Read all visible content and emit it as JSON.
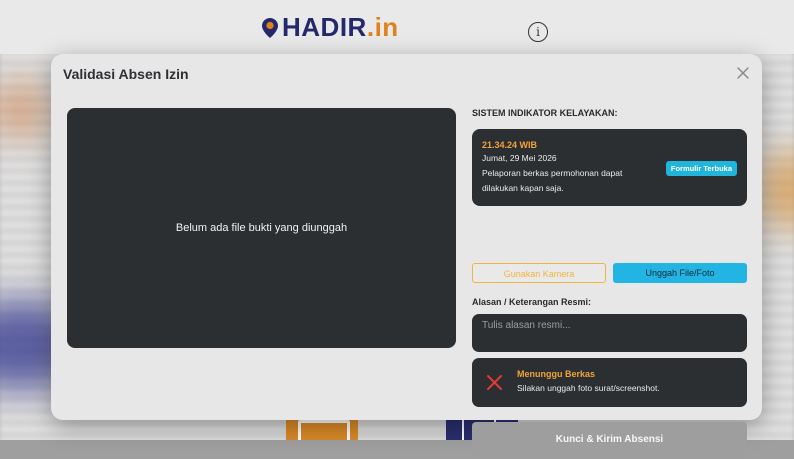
{
  "background": {
    "logo_main": "HADIR",
    "logo_tld": ".in",
    "info_glyph": "i"
  },
  "modal": {
    "title": "Validasi Absen Izin",
    "close_icon": "close-icon",
    "preview": {
      "empty_text": "Belum ada file bukti yang diunggah"
    },
    "indicator": {
      "label": "SISTEM INDIKATOR KELAYAKAN:",
      "time": "21.34.24 WIB",
      "date": "Jumat, 29 Mei 2026",
      "description": "Pelaporan berkas permohonan dapat dilakukan kapan saja.",
      "badge": "Formulir Terbuka"
    },
    "buttons": {
      "camera": "Gunakan Kamera",
      "upload": "Unggah File/Foto"
    },
    "reason": {
      "label": "Alasan / Keterangan Resmi:",
      "placeholder": "Tulis alasan resmi...",
      "value": ""
    },
    "status": {
      "icon": "x-mark-icon",
      "title": "Menunggu Berkas",
      "description": "Silakan unggah foto surat/screenshot."
    },
    "submit_label": "Kunci & Kirim Absensi"
  },
  "colors": {
    "accent_orange": "#f2a33a",
    "accent_cyan": "#22b5e4",
    "dark_panel": "#2c2f32",
    "error_red": "#e53935",
    "disabled_button": "#9e9e9e"
  }
}
